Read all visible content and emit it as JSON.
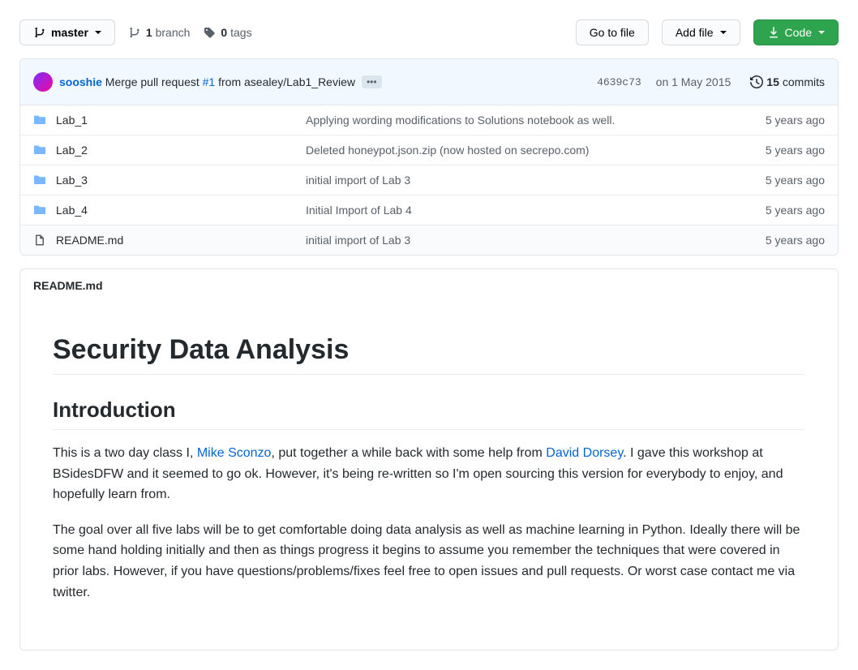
{
  "toolbar": {
    "branch_selector": {
      "label": "master"
    },
    "branches": {
      "count": "1",
      "label": "branch"
    },
    "tags": {
      "count": "0",
      "label": "tags"
    },
    "go_to_file": "Go to file",
    "add_file": "Add file",
    "code": "Code"
  },
  "latest_commit": {
    "author": "sooshie",
    "message_prefix": "Merge pull request ",
    "pr_link": "#1",
    "message_suffix": " from asealey/Lab1_Review",
    "sha": "4639c73",
    "date": "on 1 May 2015",
    "commits_count": "15",
    "commits_label": "commits"
  },
  "files": [
    {
      "type": "dir",
      "name": "Lab_1",
      "message": "Applying wording modifications to Solutions notebook as well.",
      "age": "5 years ago"
    },
    {
      "type": "dir",
      "name": "Lab_2",
      "message": "Deleted honeypot.json.zip (now hosted on secrepo.com)",
      "age": "5 years ago"
    },
    {
      "type": "dir",
      "name": "Lab_3",
      "message": "initial import of Lab 3",
      "age": "5 years ago"
    },
    {
      "type": "dir",
      "name": "Lab_4",
      "message": "Initial Import of Lab 4",
      "age": "5 years ago"
    },
    {
      "type": "file",
      "name": "README.md",
      "message": "initial import of Lab 3",
      "age": "5 years ago"
    }
  ],
  "readme": {
    "filename": "README.md",
    "h1": "Security Data Analysis",
    "h2": "Introduction",
    "p1_a": "This is a two day class I, ",
    "p1_link1": "Mike Sconzo",
    "p1_b": ", put together a while back with some help from ",
    "p1_link2": "David Dorsey",
    "p1_c": ". I gave this workshop at BSidesDFW and it seemed to go ok. However, it's being re-written so I'm open sourcing this version for everybody to enjoy, and hopefully learn from.",
    "p2": "The goal over all five labs will be to get comfortable doing data analysis as well as machine learning in Python. Ideally there will be some hand holding initially and then as things progress it begins to assume you remember the techniques that were covered in prior labs. However, if you have questions/problems/fixes feel free to open issues and pull requests. Or worst case contact me via twitter."
  }
}
